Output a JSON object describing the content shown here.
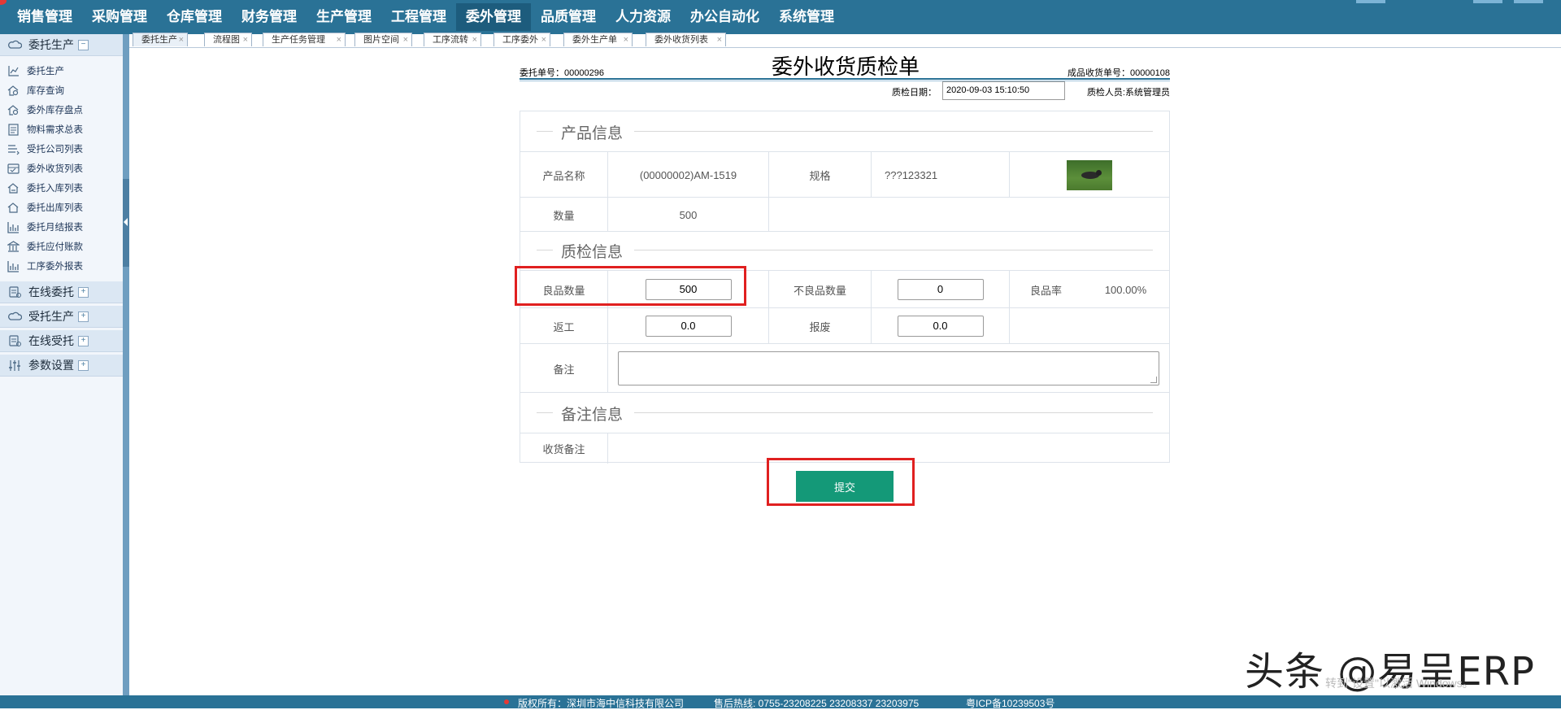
{
  "nav": {
    "items": [
      "销售管理",
      "采购管理",
      "仓库管理",
      "财务管理",
      "生产管理",
      "工程管理",
      "委外管理",
      "品质管理",
      "人力资源",
      "办公自动化",
      "系统管理"
    ],
    "active_index": 6,
    "bg_color": "#2A7296"
  },
  "sidebar": {
    "group_main": "委托生产",
    "group_main_toggle": "−",
    "items": [
      "委托生产",
      "库存查询",
      "委外库存盘点",
      "物料需求总表",
      "受托公司列表",
      "委外收货列表",
      "委托入库列表",
      "委托出库列表",
      "委托月结报表",
      "委托应付账款",
      "工序委外报表"
    ],
    "groups_collapsed": [
      "在线委托",
      "受托生产",
      "在线受托",
      "参数设置"
    ],
    "toggle_collapsed": "+"
  },
  "tabs": [
    "委托生产",
    "流程图",
    "生产任务管理",
    "图片空间",
    "工序流转",
    "工序委外",
    "委外生产单",
    "委外收货列表"
  ],
  "tab_close": "×",
  "form": {
    "title": "委外收货质检单",
    "entrust_no": "委托单号：00000296",
    "receipt_no": "成品收货单号：00000108",
    "qc_date_label": "质检日期：",
    "qc_date": "2020-09-03 15:10:50",
    "qc_person": "质检人员:系统管理员",
    "section_product": "产品信息",
    "product_name_label": "产品名称",
    "product_name": "(00000002)AM-1519",
    "spec_label": "规格",
    "spec": "???123321",
    "qty_label": "数量",
    "qty": "500",
    "section_qc": "质检信息",
    "good_qty_label": "良品数量",
    "good_qty": "500",
    "bad_qty_label": "不良品数量",
    "bad_qty": "0",
    "good_rate_label": "良品率",
    "good_rate": "100.00%",
    "rework_label": "返工",
    "rework": "0.0",
    "scrap_label": "报废",
    "scrap": "0.0",
    "remark_label": "备注",
    "remark": "",
    "section_remark": "备注信息",
    "receipt_remark_label": "收货备注",
    "receipt_remark": "",
    "submit_label": "提交",
    "submit_color": "#149978",
    "highlight_color": "#e02020"
  },
  "watermark": {
    "text": "头条 @易呈ERP",
    "faint": "转到\"设置\"以激活 Windows。"
  },
  "footer": {
    "copyright": "版权所有：深圳市海中信科技有限公司",
    "hotline": "售后热线: 0755-23208225  23208337  23203975",
    "icp": "粤ICP备10239503号"
  }
}
